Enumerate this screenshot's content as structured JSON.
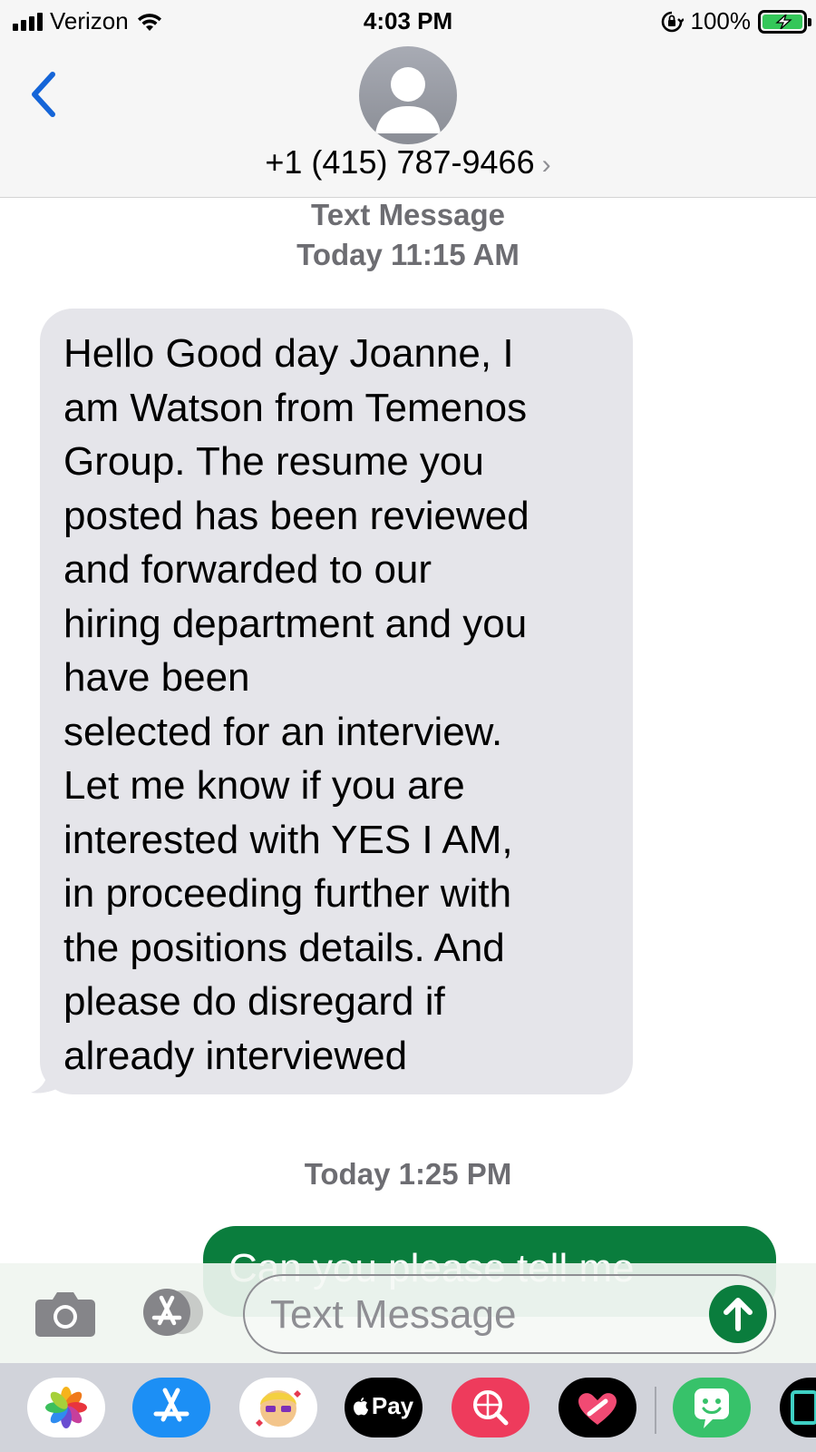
{
  "status_bar": {
    "carrier": "Verizon",
    "time": "4:03 PM",
    "battery_percent": "100%",
    "icons": [
      "signal-icon",
      "wifi-icon",
      "rotation-lock-icon",
      "battery-charging-icon"
    ]
  },
  "header": {
    "back_icon": "chevron-left-icon",
    "avatar_icon": "person-icon",
    "contact": "+1 (415) 787-9466",
    "contact_chevron": "›"
  },
  "thread": {
    "service_label": "Text Message",
    "first_timestamp": "Today 11:15 AM",
    "incoming_message": "Hello Good day Joanne, I\nam Watson from Temenos\nGroup. The resume you\nposted has been reviewed\nand forwarded to our\nhiring department and you\nhave been\nselected for an interview.\nLet me know if you are\ninterested with YES I AM,\nin proceeding further with\nthe positions details. And\nplease do disregard if\nalready interviewed",
    "second_timestamp": "Today 1:25 PM",
    "outgoing_message_partial": "Can you please tell me"
  },
  "composer": {
    "camera_icon": "camera-icon",
    "apps_icon": "app-store-icon",
    "placeholder": "Text Message",
    "send_icon": "arrow-up-icon"
  },
  "app_drawer": {
    "apps": [
      "photos-icon",
      "app-store-icon",
      "memoji-icon",
      "apple-pay-icon",
      "search-images-icon",
      "digital-touch-icon",
      "sticker-app-icon",
      "more-app-icon"
    ],
    "apple_pay_label": "Pay"
  },
  "colors": {
    "accent_blue": "#1565d8",
    "bubble_incoming": "#e5e5ea",
    "bubble_outgoing": "#0a7d3d",
    "meta_gray": "#6d6d72"
  }
}
